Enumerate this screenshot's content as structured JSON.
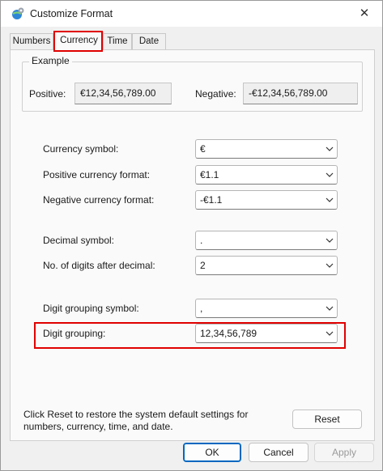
{
  "window": {
    "title": "Customize Format",
    "close_icon": "close-icon",
    "app_icon": "settings-globe-icon"
  },
  "tabs": [
    {
      "label": "Numbers",
      "active": false
    },
    {
      "label": "Currency",
      "active": true
    },
    {
      "label": "Time",
      "active": false
    },
    {
      "label": "Date",
      "active": false
    }
  ],
  "example": {
    "legend": "Example",
    "positive_label": "Positive:",
    "positive_value": "€12,34,56,789.00",
    "negative_label": "Negative:",
    "negative_value": "-€12,34,56,789.00"
  },
  "settings": {
    "currency_symbol": {
      "label": "Currency symbol:",
      "value": "€"
    },
    "positive_format": {
      "label": "Positive currency format:",
      "value": "€1.1"
    },
    "negative_format": {
      "label": "Negative currency format:",
      "value": "-€1.1"
    },
    "decimal_symbol": {
      "label": "Decimal symbol:",
      "value": "."
    },
    "digits_after_decimal": {
      "label": "No. of digits after decimal:",
      "value": "2"
    },
    "digit_grouping_symbol": {
      "label": "Digit grouping symbol:",
      "value": ","
    },
    "digit_grouping": {
      "label": "Digit grouping:",
      "value": "12,34,56,789"
    }
  },
  "footer": {
    "reset_text": "Click Reset to restore the system default settings for numbers, currency, time, and date.",
    "reset_label": "Reset"
  },
  "buttons": {
    "ok": "OK",
    "cancel": "Cancel",
    "apply": "Apply"
  },
  "colors": {
    "highlight": "#e00000",
    "primary_border": "#0067c0"
  }
}
